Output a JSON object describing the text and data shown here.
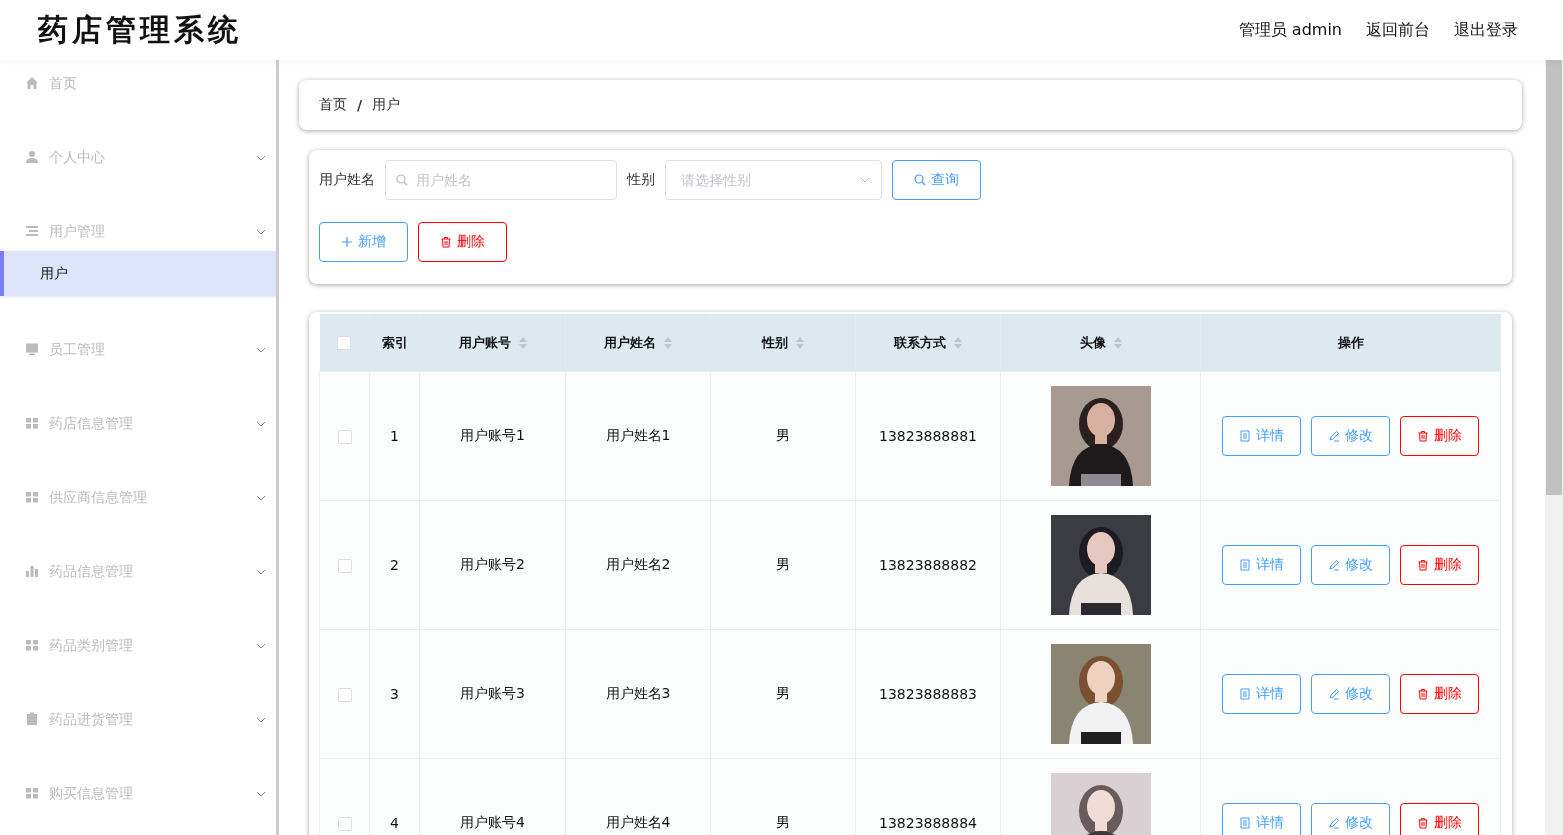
{
  "header": {
    "title": "药店管理系统",
    "links": [
      "管理员 admin",
      "返回前台",
      "退出登录"
    ]
  },
  "sidebar": {
    "items": [
      {
        "label": "首页",
        "kind": "link"
      },
      {
        "label": "个人中心",
        "kind": "menu",
        "expanded": false
      },
      {
        "label": "用户管理",
        "kind": "menu",
        "expanded": true,
        "children": [
          {
            "label": "用户",
            "selected": true
          }
        ]
      },
      {
        "label": "员工管理",
        "kind": "menu",
        "expanded": false
      },
      {
        "label": "药店信息管理",
        "kind": "menu",
        "expanded": false
      },
      {
        "label": "供应商信息管理",
        "kind": "menu",
        "expanded": false
      },
      {
        "label": "药品信息管理",
        "kind": "menu",
        "expanded": false
      },
      {
        "label": "药品类别管理",
        "kind": "menu",
        "expanded": false
      },
      {
        "label": "药品进货管理",
        "kind": "menu",
        "expanded": false
      },
      {
        "label": "购买信息管理",
        "kind": "menu",
        "expanded": false
      }
    ]
  },
  "breadcrumb": [
    "首页",
    "/",
    "用户"
  ],
  "search": {
    "name_label": "用户姓名",
    "name_placeholder": "用户姓名",
    "gender_label": "性别",
    "gender_placeholder": "请选择性别",
    "query_button": "查询",
    "add_button": "新增",
    "delete_button": "删除"
  },
  "table": {
    "header_checked": false,
    "columns": [
      {
        "label": "索引",
        "sortable": false
      },
      {
        "label": "用户账号",
        "sortable": true
      },
      {
        "label": "用户姓名",
        "sortable": true
      },
      {
        "label": "性别",
        "sortable": true
      },
      {
        "label": "联系方式",
        "sortable": true
      },
      {
        "label": "头像",
        "sortable": true
      },
      {
        "label": "操作",
        "sortable": false
      }
    ],
    "rows": [
      {
        "checked": false,
        "index": "1",
        "account": "用户账号1",
        "name": "用户姓名1",
        "gender": "男",
        "phone": "13823888881",
        "avatar": {
          "kind": "picture"
        },
        "actions": [
          "详情",
          "修改",
          "删除"
        ]
      },
      {
        "checked": false,
        "index": "2",
        "account": "用户账号2",
        "name": "用户姓名2",
        "gender": "男",
        "phone": "13823888882",
        "avatar": {
          "kind": "picture"
        },
        "actions": [
          "详情",
          "修改",
          "删除"
        ]
      },
      {
        "checked": false,
        "index": "3",
        "account": "用户账号3",
        "name": "用户姓名3",
        "gender": "男",
        "phone": "13823888883",
        "avatar": {
          "kind": "picture"
        },
        "actions": [
          "详情",
          "修改",
          "删除"
        ]
      },
      {
        "checked": false,
        "index": "4",
        "account": "用户账号4",
        "name": "用户姓名4",
        "gender": "男",
        "phone": "13823888884",
        "avatar": {
          "kind": "picture"
        },
        "actions": [
          "详情",
          "修改",
          "删除"
        ]
      }
    ]
  }
}
